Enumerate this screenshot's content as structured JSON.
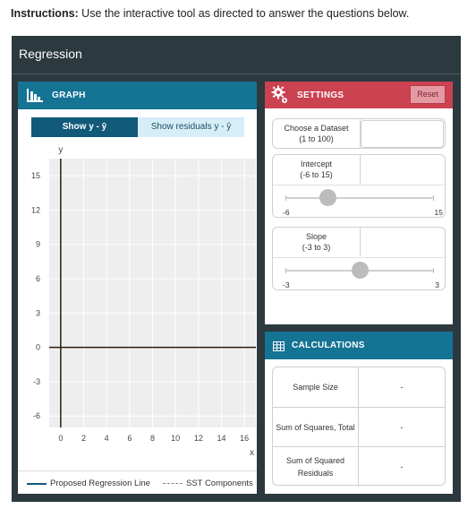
{
  "instructions": {
    "bold": "Instructions:",
    "text": " Use the interactive tool as directed to answer the questions below."
  },
  "app": {
    "title": "Regression"
  },
  "graph": {
    "header_label": "GRAPH",
    "toggle": {
      "active_label": "Show y - ȳ",
      "inactive_label": "Show residuals y - ŷ"
    },
    "legend": {
      "solid_label": "Proposed Regression Line",
      "dashed_label": "SST Components"
    },
    "colors": {
      "plot_bg": "#eeeeee",
      "axis": "#2b1d0e",
      "grid": "#ffffff"
    }
  },
  "chart_data": {
    "type": "line",
    "xlabel": "x",
    "ylabel": "y",
    "xlim": [
      -1,
      17
    ],
    "ylim": [
      -7,
      16.5
    ],
    "x_ticks": [
      0,
      2,
      4,
      6,
      8,
      10,
      12,
      14,
      16
    ],
    "y_ticks": [
      15,
      12,
      9,
      6,
      3,
      0,
      -3,
      -6
    ],
    "grid": true,
    "series": []
  },
  "settings": {
    "header_label": "SETTINGS",
    "reset_label": "Reset",
    "dataset": {
      "label": "Choose a Dataset",
      "range": "(1 to 100)",
      "value": ""
    },
    "intercept": {
      "label": "Intercept",
      "range": "(-6 to 15)",
      "min_label": "-6",
      "max_label": "15",
      "min": -6,
      "max": 15,
      "value": 0
    },
    "slope": {
      "label": "Slope",
      "range": "(-3 to 3)",
      "min_label": "-3",
      "max_label": "3",
      "min": -3,
      "max": 3,
      "value": 0
    }
  },
  "calculations": {
    "header_label": "CALCULATIONS",
    "rows": [
      {
        "name": "Sample Size",
        "value": "-"
      },
      {
        "name": "Sum of Squares, Total",
        "value": "-"
      },
      {
        "name": "Sum of Squared Residuals",
        "value": "-"
      }
    ]
  }
}
